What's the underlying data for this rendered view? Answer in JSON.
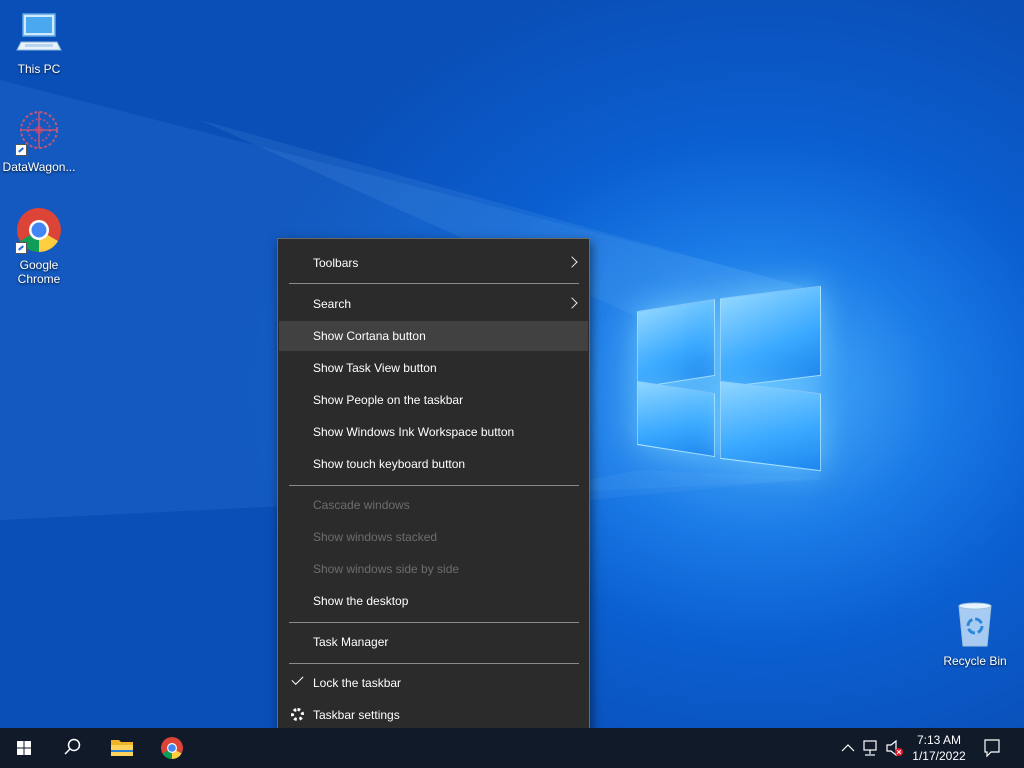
{
  "desktop": {
    "icons": [
      {
        "label": "This PC",
        "icon": "computer-icon"
      },
      {
        "label": "DataWagon...",
        "icon": "datawagon-icon"
      },
      {
        "label": "Google Chrome",
        "icon": "chrome-icon"
      },
      {
        "label": "Recycle Bin",
        "icon": "recycle-bin-icon"
      }
    ]
  },
  "context_menu": {
    "items": {
      "toolbars": "Toolbars",
      "search": "Search",
      "show_cortana": "Show Cortana button",
      "show_task_view": "Show Task View button",
      "show_people": "Show People on the taskbar",
      "show_ink": "Show Windows Ink Workspace button",
      "show_touch_keyboard": "Show touch keyboard button",
      "cascade": "Cascade windows",
      "stacked": "Show windows stacked",
      "side_by_side": "Show windows side by side",
      "show_desktop": "Show the desktop",
      "task_manager": "Task Manager",
      "lock_taskbar": "Lock the taskbar",
      "taskbar_settings": "Taskbar settings"
    },
    "hovered_item": "Show Cortana button",
    "lock_taskbar_checked": true
  },
  "taskbar": {
    "pinned": [
      "start-icon",
      "search-icon",
      "file-explorer-icon",
      "chrome-icon"
    ],
    "clock": {
      "time": "7:13 AM",
      "date": "1/17/2022"
    }
  },
  "colors": {
    "menu_bg": "#2b2b2b",
    "menu_hover": "#414141",
    "taskbar_bg": "#101a29",
    "disabled_text": "#6d6d6d"
  }
}
